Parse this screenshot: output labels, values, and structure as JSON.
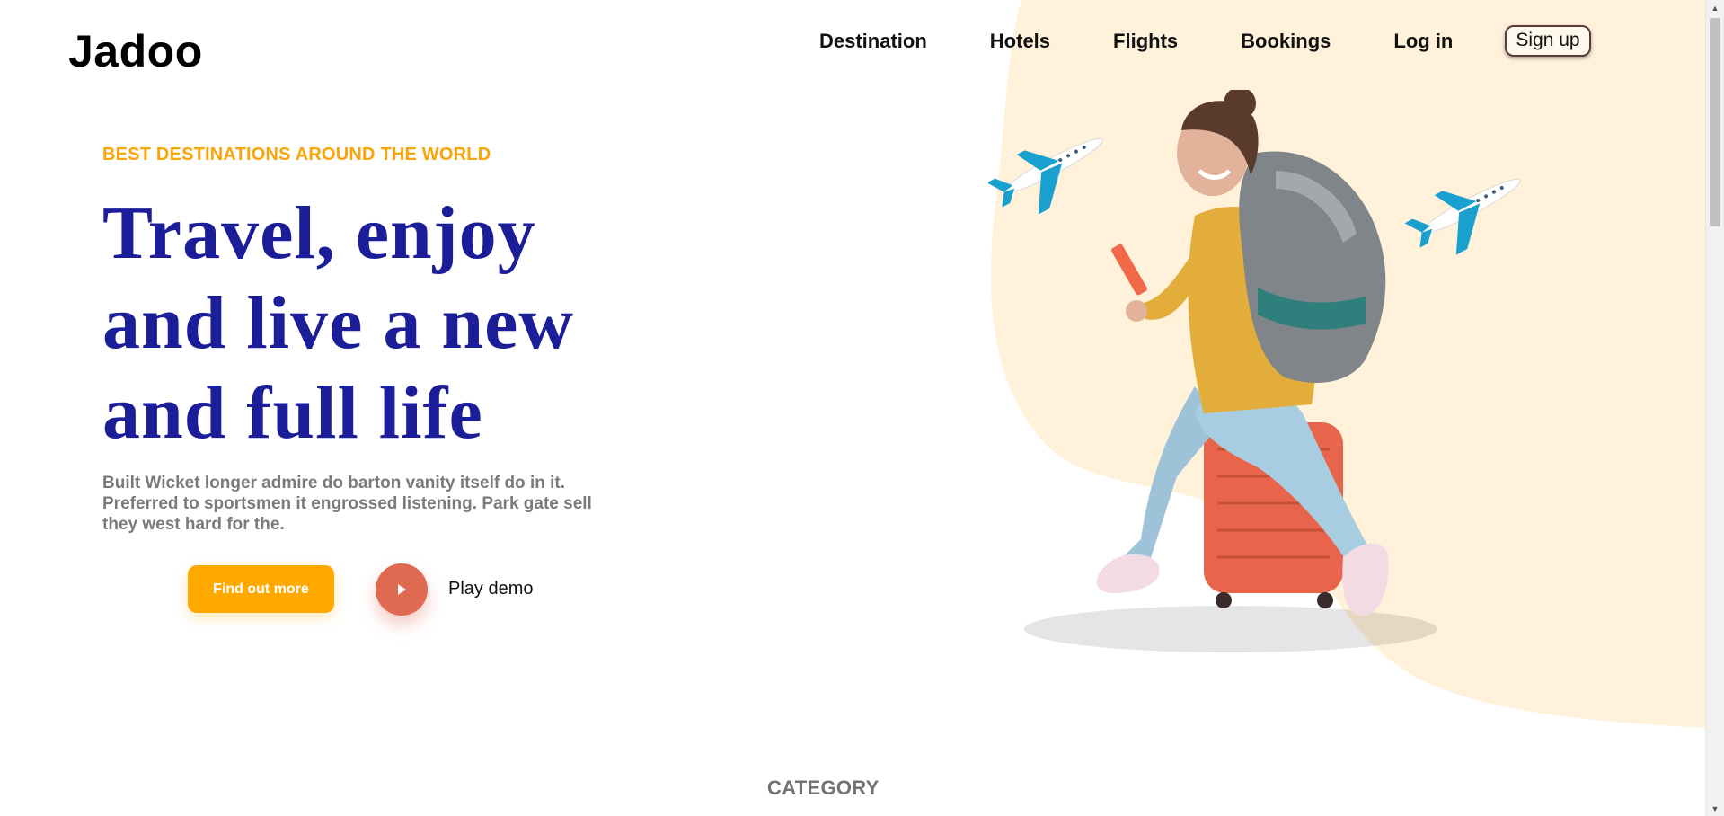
{
  "brand": {
    "logo": "Jadoo"
  },
  "nav": {
    "items": [
      {
        "label": "Destination"
      },
      {
        "label": "Hotels"
      },
      {
        "label": "Flights"
      },
      {
        "label": "Bookings"
      },
      {
        "label": "Log in"
      }
    ],
    "signup_label": "Sign up"
  },
  "hero": {
    "tagline": "BEST DESTINATIONS AROUND THE WORLD",
    "headline": "Travel, enjoy and live a new and full life",
    "description": "Built Wicket longer admire do barton vanity itself do in it. Preferred to sportsmen it engrossed listening. Park gate sell they west hard for the.",
    "find_out_more_label": "Find out more",
    "play_demo_label": "Play demo"
  },
  "section": {
    "category_label": "CATEGORY"
  },
  "colors": {
    "accent_yellow": "#ffa800",
    "headline_blue": "#1c1d98",
    "play_red": "#df6951",
    "blob_peach": "#fff1da",
    "muted_gray": "#7a7a7a"
  },
  "icons": {
    "play": "play-icon",
    "airplane": "airplane-icon",
    "scroll_up": "chevron-up-icon",
    "scroll_down": "chevron-down-icon"
  }
}
